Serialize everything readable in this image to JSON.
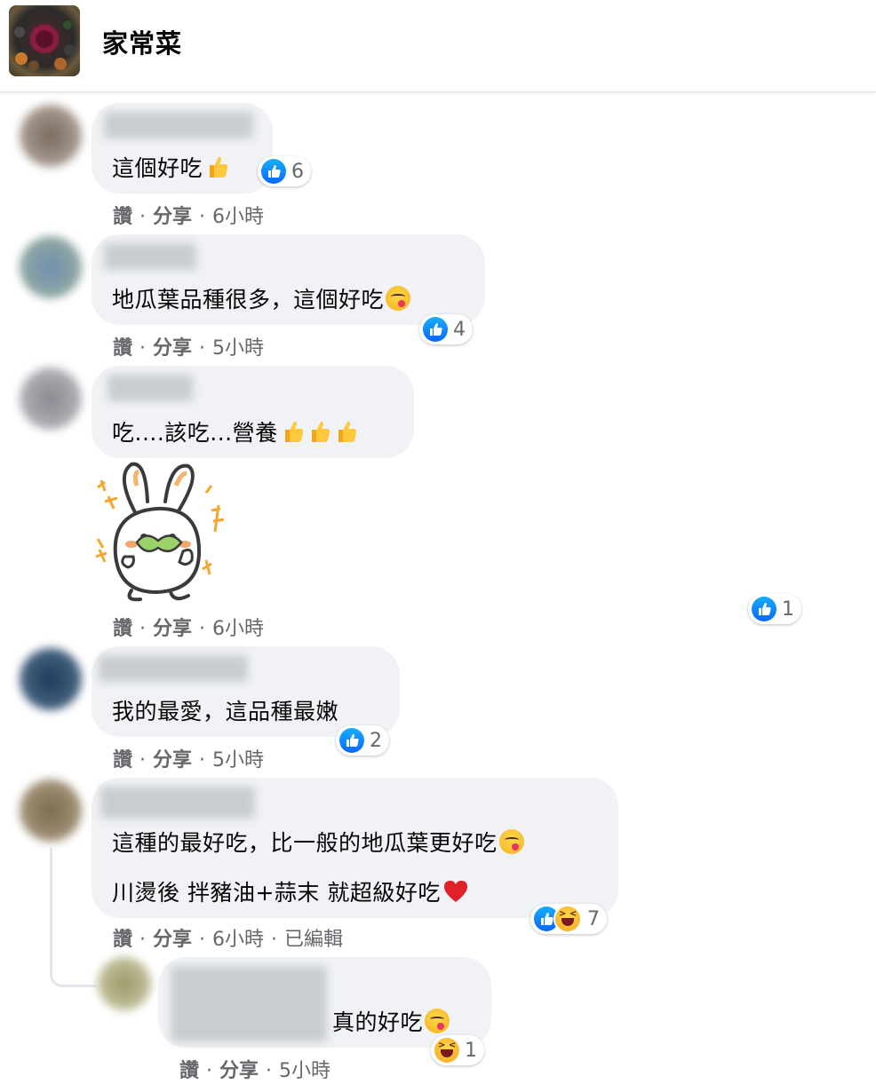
{
  "header": {
    "group_name": "家常菜"
  },
  "colors": {
    "like_blue": "#0866ff",
    "bubble_bg": "#f0f2f5",
    "meta_gray": "#65676b"
  },
  "actions": {
    "like": "讚",
    "share": "分享"
  },
  "comments": [
    {
      "text": "這個好吃",
      "time": "6小時",
      "reaction_count": "6"
    },
    {
      "text": "地瓜葉品種很多，這個好吃",
      "time": "5小時",
      "reaction_count": "4"
    },
    {
      "text": "吃....該吃...營養",
      "time": "6小時",
      "reaction_count": "1",
      "sticker": "rabbit-eating-leaf-sticker"
    },
    {
      "text": "我的最愛，這品種最嫩",
      "time": "5小時",
      "reaction_count": "2"
    },
    {
      "text_line1": "這種的最好吃，比一般的地瓜葉更好吃",
      "text_line2": "川燙後 拌豬油+蒜末 就超級好吃",
      "time": "6小時",
      "edited": "已編輯",
      "reaction_count": "7"
    },
    {
      "text": "真的好吃",
      "time": "5小時",
      "reaction_count": "1"
    }
  ]
}
